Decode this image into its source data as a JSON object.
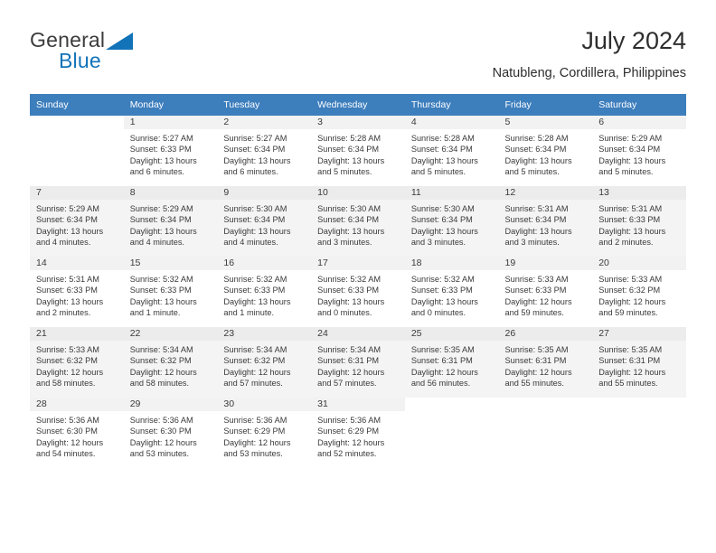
{
  "brand": {
    "name_part1": "General",
    "name_part2": "Blue",
    "triangle_icon": "triangle-icon"
  },
  "header": {
    "title": "July 2024",
    "subtitle": "Natubleng, Cordillera, Philippines"
  },
  "colors": {
    "header_row": "#3d7ebd",
    "brand_blue": "#1273b8",
    "alt_row": "#f4f4f4",
    "daynum_bar": "#f2f2f2",
    "text": "#3a3a3a"
  },
  "weekday_headers": [
    "Sunday",
    "Monday",
    "Tuesday",
    "Wednesday",
    "Thursday",
    "Friday",
    "Saturday"
  ],
  "weeks": [
    [
      {
        "day": "",
        "lines": []
      },
      {
        "day": "1",
        "lines": [
          "Sunrise: 5:27 AM",
          "Sunset: 6:33 PM",
          "Daylight: 13 hours",
          "and 6 minutes."
        ]
      },
      {
        "day": "2",
        "lines": [
          "Sunrise: 5:27 AM",
          "Sunset: 6:34 PM",
          "Daylight: 13 hours",
          "and 6 minutes."
        ]
      },
      {
        "day": "3",
        "lines": [
          "Sunrise: 5:28 AM",
          "Sunset: 6:34 PM",
          "Daylight: 13 hours",
          "and 5 minutes."
        ]
      },
      {
        "day": "4",
        "lines": [
          "Sunrise: 5:28 AM",
          "Sunset: 6:34 PM",
          "Daylight: 13 hours",
          "and 5 minutes."
        ]
      },
      {
        "day": "5",
        "lines": [
          "Sunrise: 5:28 AM",
          "Sunset: 6:34 PM",
          "Daylight: 13 hours",
          "and 5 minutes."
        ]
      },
      {
        "day": "6",
        "lines": [
          "Sunrise: 5:29 AM",
          "Sunset: 6:34 PM",
          "Daylight: 13 hours",
          "and 5 minutes."
        ]
      }
    ],
    [
      {
        "day": "7",
        "lines": [
          "Sunrise: 5:29 AM",
          "Sunset: 6:34 PM",
          "Daylight: 13 hours",
          "and 4 minutes."
        ]
      },
      {
        "day": "8",
        "lines": [
          "Sunrise: 5:29 AM",
          "Sunset: 6:34 PM",
          "Daylight: 13 hours",
          "and 4 minutes."
        ]
      },
      {
        "day": "9",
        "lines": [
          "Sunrise: 5:30 AM",
          "Sunset: 6:34 PM",
          "Daylight: 13 hours",
          "and 4 minutes."
        ]
      },
      {
        "day": "10",
        "lines": [
          "Sunrise: 5:30 AM",
          "Sunset: 6:34 PM",
          "Daylight: 13 hours",
          "and 3 minutes."
        ]
      },
      {
        "day": "11",
        "lines": [
          "Sunrise: 5:30 AM",
          "Sunset: 6:34 PM",
          "Daylight: 13 hours",
          "and 3 minutes."
        ]
      },
      {
        "day": "12",
        "lines": [
          "Sunrise: 5:31 AM",
          "Sunset: 6:34 PM",
          "Daylight: 13 hours",
          "and 3 minutes."
        ]
      },
      {
        "day": "13",
        "lines": [
          "Sunrise: 5:31 AM",
          "Sunset: 6:33 PM",
          "Daylight: 13 hours",
          "and 2 minutes."
        ]
      }
    ],
    [
      {
        "day": "14",
        "lines": [
          "Sunrise: 5:31 AM",
          "Sunset: 6:33 PM",
          "Daylight: 13 hours",
          "and 2 minutes."
        ]
      },
      {
        "day": "15",
        "lines": [
          "Sunrise: 5:32 AM",
          "Sunset: 6:33 PM",
          "Daylight: 13 hours",
          "and 1 minute."
        ]
      },
      {
        "day": "16",
        "lines": [
          "Sunrise: 5:32 AM",
          "Sunset: 6:33 PM",
          "Daylight: 13 hours",
          "and 1 minute."
        ]
      },
      {
        "day": "17",
        "lines": [
          "Sunrise: 5:32 AM",
          "Sunset: 6:33 PM",
          "Daylight: 13 hours",
          "and 0 minutes."
        ]
      },
      {
        "day": "18",
        "lines": [
          "Sunrise: 5:32 AM",
          "Sunset: 6:33 PM",
          "Daylight: 13 hours",
          "and 0 minutes."
        ]
      },
      {
        "day": "19",
        "lines": [
          "Sunrise: 5:33 AM",
          "Sunset: 6:33 PM",
          "Daylight: 12 hours",
          "and 59 minutes."
        ]
      },
      {
        "day": "20",
        "lines": [
          "Sunrise: 5:33 AM",
          "Sunset: 6:32 PM",
          "Daylight: 12 hours",
          "and 59 minutes."
        ]
      }
    ],
    [
      {
        "day": "21",
        "lines": [
          "Sunrise: 5:33 AM",
          "Sunset: 6:32 PM",
          "Daylight: 12 hours",
          "and 58 minutes."
        ]
      },
      {
        "day": "22",
        "lines": [
          "Sunrise: 5:34 AM",
          "Sunset: 6:32 PM",
          "Daylight: 12 hours",
          "and 58 minutes."
        ]
      },
      {
        "day": "23",
        "lines": [
          "Sunrise: 5:34 AM",
          "Sunset: 6:32 PM",
          "Daylight: 12 hours",
          "and 57 minutes."
        ]
      },
      {
        "day": "24",
        "lines": [
          "Sunrise: 5:34 AM",
          "Sunset: 6:31 PM",
          "Daylight: 12 hours",
          "and 57 minutes."
        ]
      },
      {
        "day": "25",
        "lines": [
          "Sunrise: 5:35 AM",
          "Sunset: 6:31 PM",
          "Daylight: 12 hours",
          "and 56 minutes."
        ]
      },
      {
        "day": "26",
        "lines": [
          "Sunrise: 5:35 AM",
          "Sunset: 6:31 PM",
          "Daylight: 12 hours",
          "and 55 minutes."
        ]
      },
      {
        "day": "27",
        "lines": [
          "Sunrise: 5:35 AM",
          "Sunset: 6:31 PM",
          "Daylight: 12 hours",
          "and 55 minutes."
        ]
      }
    ],
    [
      {
        "day": "28",
        "lines": [
          "Sunrise: 5:36 AM",
          "Sunset: 6:30 PM",
          "Daylight: 12 hours",
          "and 54 minutes."
        ]
      },
      {
        "day": "29",
        "lines": [
          "Sunrise: 5:36 AM",
          "Sunset: 6:30 PM",
          "Daylight: 12 hours",
          "and 53 minutes."
        ]
      },
      {
        "day": "30",
        "lines": [
          "Sunrise: 5:36 AM",
          "Sunset: 6:29 PM",
          "Daylight: 12 hours",
          "and 53 minutes."
        ]
      },
      {
        "day": "31",
        "lines": [
          "Sunrise: 5:36 AM",
          "Sunset: 6:29 PM",
          "Daylight: 12 hours",
          "and 52 minutes."
        ]
      },
      {
        "day": "",
        "lines": []
      },
      {
        "day": "",
        "lines": []
      },
      {
        "day": "",
        "lines": []
      }
    ]
  ]
}
